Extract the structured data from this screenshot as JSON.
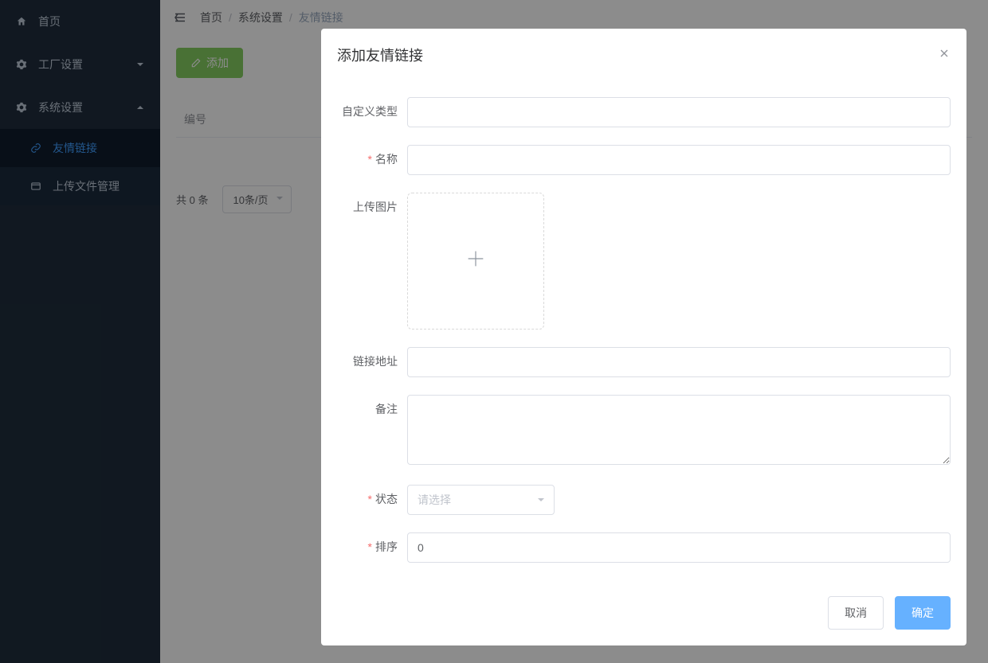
{
  "sidebar": {
    "items": [
      {
        "label": "首页",
        "icon": "home-icon"
      },
      {
        "label": "工厂设置",
        "icon": "gear-icon",
        "hasChildren": true,
        "expanded": false
      },
      {
        "label": "系统设置",
        "icon": "gear-icon",
        "hasChildren": true,
        "expanded": true,
        "children": [
          {
            "label": "友情链接",
            "icon": "link-icon",
            "active": true
          },
          {
            "label": "上传文件管理",
            "icon": "folder-icon",
            "active": false
          }
        ]
      }
    ]
  },
  "breadcrumb": {
    "items": [
      "首页",
      "系统设置",
      "友情链接"
    ]
  },
  "toolbar": {
    "add_label": "添加"
  },
  "table": {
    "columns": [
      "编号"
    ]
  },
  "pagination": {
    "total_text": "共 0 条",
    "per_page": "10条/页"
  },
  "dialog": {
    "title": "添加友情链接",
    "fields": {
      "custom_type_label": "自定义类型",
      "name_label": "名称",
      "upload_label": "上传图片",
      "url_label": "链接地址",
      "remark_label": "备注",
      "status_label": "状态",
      "status_placeholder": "请选择",
      "sort_label": "排序",
      "sort_value": "0"
    },
    "cancel_label": "取消",
    "confirm_label": "确定"
  }
}
